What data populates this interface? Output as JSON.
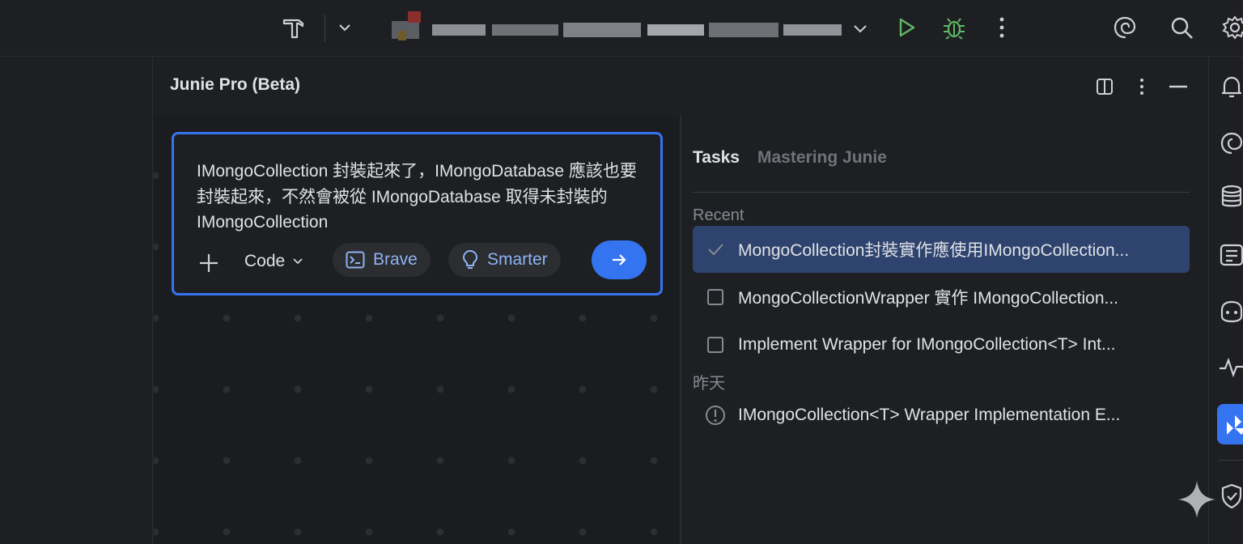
{
  "toolbar": {
    "icons": [
      "hammer-icon",
      "chevron-down-icon",
      "run-icon",
      "debug-icon",
      "more-vertical-icon",
      "ai-spiral-icon",
      "search-icon",
      "settings-icon"
    ],
    "colors": {
      "run": "#5fb865",
      "debug": "#5fb865"
    }
  },
  "junie": {
    "title": "Junie Pro (Beta)",
    "header_icons": [
      "split-panel-icon",
      "more-vertical-icon",
      "minimize-icon"
    ]
  },
  "prompt": {
    "text": "IMongoCollection 封裝起來了，IMongoDatabase 應該也要封裝起來，不然會被從 IMongoDatabase 取得未封裝的 IMongoCollection",
    "mode": "Code",
    "brave_label": "Brave",
    "smarter_label": "Smarter",
    "accent": "#3574f0"
  },
  "tasks_panel": {
    "tabs": [
      "Tasks",
      "Mastering Junie"
    ],
    "groups": [
      {
        "label": "Recent",
        "items": [
          {
            "title": "MongoCollection封裝實作應使用IMongoCollection...",
            "status": "done"
          },
          {
            "title": "MongoCollectionWrapper 實作 IMongoCollection...",
            "status": "todo"
          },
          {
            "title": "Implement Wrapper for IMongoCollection<T> Int...",
            "status": "todo"
          }
        ]
      },
      {
        "label": "昨天",
        "items": [
          {
            "title": "IMongoCollection<T> Wrapper Implementation E...",
            "status": "warning"
          }
        ]
      }
    ]
  },
  "right_strip": {
    "icons": [
      "notifications-icon",
      "ai-assistant-icon",
      "database-icon",
      "structure-icon",
      "copilot-icon",
      "profiler-icon",
      "junie-icon",
      "security-icon"
    ]
  }
}
